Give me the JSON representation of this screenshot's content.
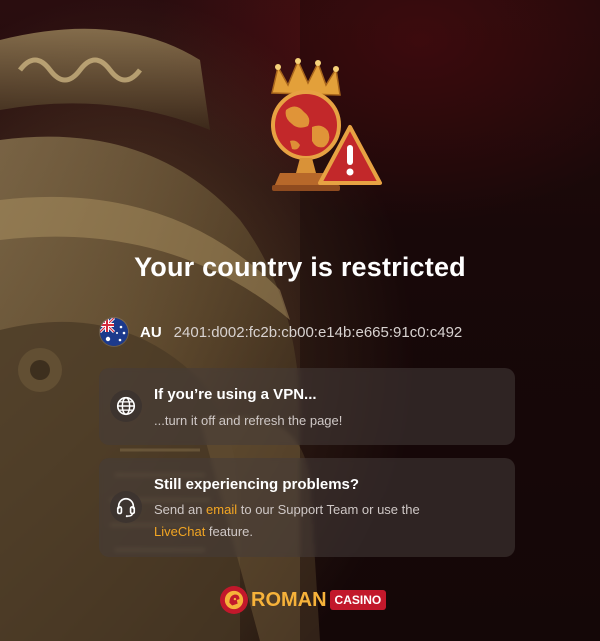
{
  "restriction": {
    "title": "Your country is restricted"
  },
  "location": {
    "flag_icon": "australia-flag-icon",
    "country_code": "AU",
    "ip_address": "2401:d002:fc2b:cb00:e14b:e665:91c0:c492"
  },
  "vpn_card": {
    "icon": "globe-icon",
    "heading": "If you’re using a VPN...",
    "text": "...turn it off and refresh the page!"
  },
  "support_card": {
    "icon": "headset-icon",
    "heading": "Still experiencing problems?",
    "text_before_email": "Send an ",
    "email_link": "email",
    "text_middle": " to our Support Team or use the",
    "livechat_link": "LiveChat",
    "text_after": " feature."
  },
  "brand": {
    "name": "ROMAN",
    "sub": "CASINO",
    "accent_color": "#f6b23a",
    "brand_red": "#c2182b"
  }
}
